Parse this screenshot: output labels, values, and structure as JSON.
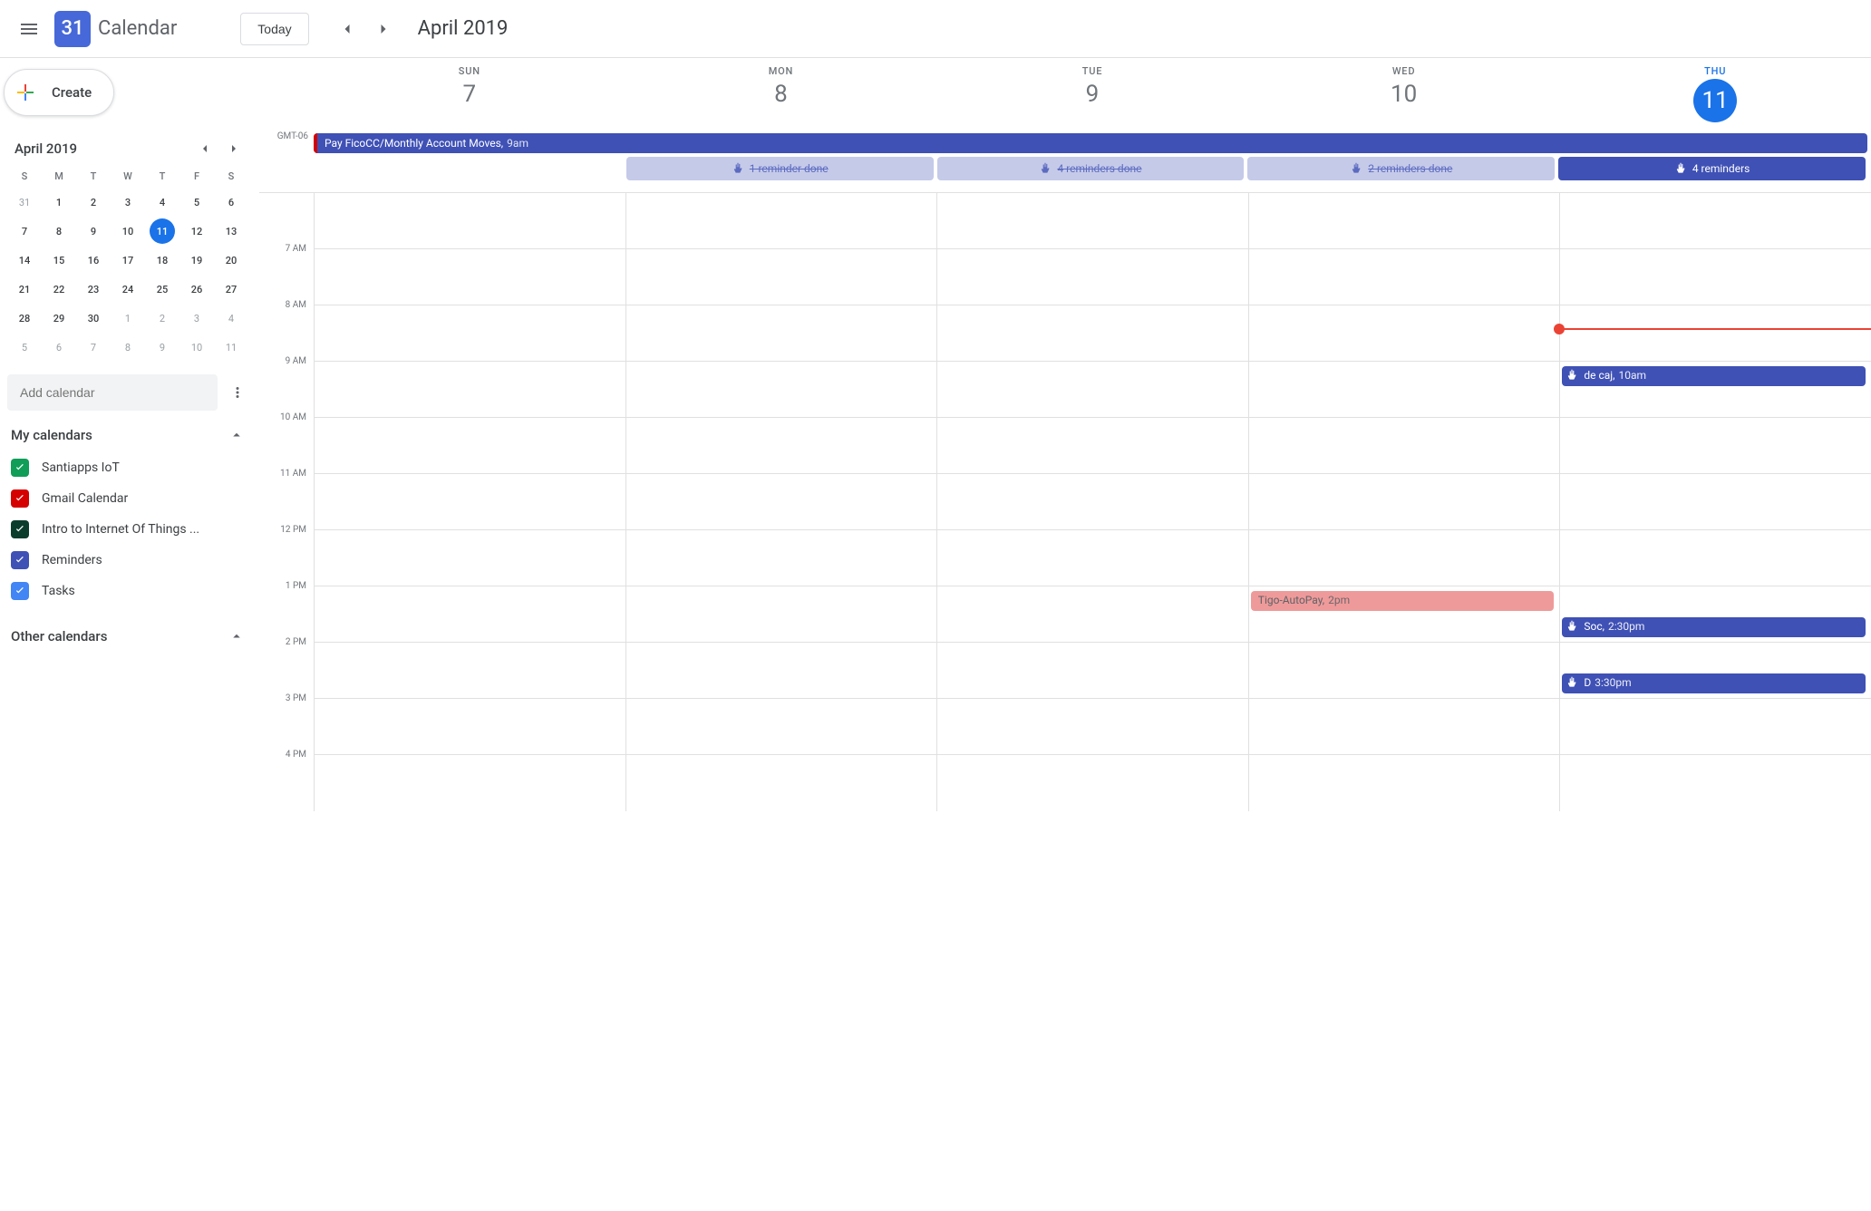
{
  "header": {
    "logo_day": "31",
    "app_name": "Calendar",
    "today_label": "Today",
    "date_range": "April 2019"
  },
  "create_label": "Create",
  "mini": {
    "title": "April 2019",
    "dow": [
      "S",
      "M",
      "T",
      "W",
      "T",
      "F",
      "S"
    ],
    "weeks": [
      [
        {
          "n": "31",
          "m": true
        },
        {
          "n": "1"
        },
        {
          "n": "2"
        },
        {
          "n": "3"
        },
        {
          "n": "4"
        },
        {
          "n": "5"
        },
        {
          "n": "6"
        }
      ],
      [
        {
          "n": "7"
        },
        {
          "n": "8"
        },
        {
          "n": "9"
        },
        {
          "n": "10"
        },
        {
          "n": "11",
          "today": true
        },
        {
          "n": "12"
        },
        {
          "n": "13"
        }
      ],
      [
        {
          "n": "14"
        },
        {
          "n": "15"
        },
        {
          "n": "16"
        },
        {
          "n": "17"
        },
        {
          "n": "18"
        },
        {
          "n": "19"
        },
        {
          "n": "20"
        }
      ],
      [
        {
          "n": "21"
        },
        {
          "n": "22"
        },
        {
          "n": "23"
        },
        {
          "n": "24"
        },
        {
          "n": "25"
        },
        {
          "n": "26"
        },
        {
          "n": "27"
        }
      ],
      [
        {
          "n": "28"
        },
        {
          "n": "29"
        },
        {
          "n": "30"
        },
        {
          "n": "1",
          "m": true
        },
        {
          "n": "2",
          "m": true
        },
        {
          "n": "3",
          "m": true
        },
        {
          "n": "4",
          "m": true
        }
      ],
      [
        {
          "n": "5",
          "m": true
        },
        {
          "n": "6",
          "m": true
        },
        {
          "n": "7",
          "m": true
        },
        {
          "n": "8",
          "m": true
        },
        {
          "n": "9",
          "m": true
        },
        {
          "n": "10",
          "m": true
        },
        {
          "n": "11",
          "m": true
        }
      ]
    ]
  },
  "add_calendar_placeholder": "Add calendar",
  "sections": {
    "my_calendars": "My calendars",
    "other_calendars": "Other calendars"
  },
  "calendars": [
    {
      "name": "Santiapps IoT",
      "color": "#0f9d58"
    },
    {
      "name": "Gmail Calendar",
      "color": "#d50000"
    },
    {
      "name": "Intro to Internet Of Things ...",
      "color": "#0b3d2c"
    },
    {
      "name": "Reminders",
      "color": "#3f51b5"
    },
    {
      "name": "Tasks",
      "color": "#4285f4"
    }
  ],
  "tz_label": "GMT-06",
  "day_headers": [
    {
      "dow": "SUN",
      "num": "7"
    },
    {
      "dow": "MON",
      "num": "8"
    },
    {
      "dow": "TUE",
      "num": "9"
    },
    {
      "dow": "WED",
      "num": "10"
    },
    {
      "dow": "THU",
      "num": "11",
      "today": true
    }
  ],
  "allday_event": {
    "title": "Pay FicoCC/Monthly Account Moves,",
    "time": "9am"
  },
  "reminder_chips": [
    {
      "label": "",
      "cls": "empty"
    },
    {
      "label": "1 reminder done",
      "cls": "done"
    },
    {
      "label": "4 reminders done",
      "cls": "done"
    },
    {
      "label": "2 reminders done",
      "cls": "done"
    },
    {
      "label": "4 reminders",
      "cls": "active"
    }
  ],
  "time_labels": [
    "7 AM",
    "8 AM",
    "9 AM",
    "10 AM",
    "11 AM",
    "12 PM",
    "1 PM",
    "2 PM",
    "3 PM",
    "4 PM"
  ],
  "events": {
    "wed_tigo": {
      "title": "Tigo-AutoPay,",
      "time": "2pm"
    },
    "thu_caj": {
      "title": "de caj,",
      "time": "10am"
    },
    "thu_soc": {
      "title": "Soc,",
      "time": "2:30pm"
    },
    "thu_d": {
      "title": "D",
      "time": "3:30pm"
    }
  },
  "now_hour": 9.4
}
